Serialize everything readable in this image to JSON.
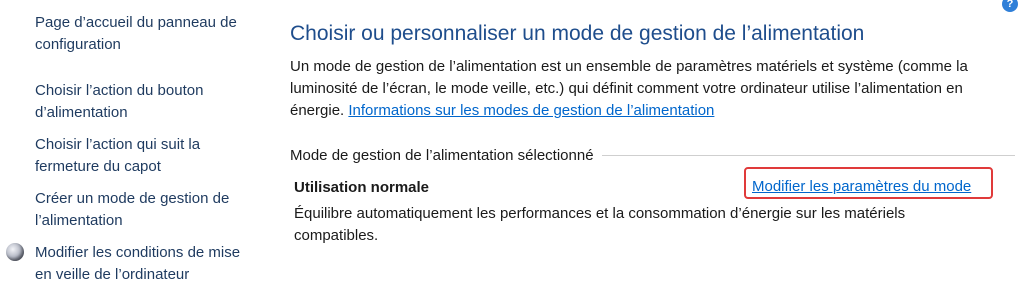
{
  "sidebar": {
    "items": [
      {
        "label": "Page d’accueil du panneau de configuration"
      },
      {
        "label": "Choisir l’action du bouton d’alimentation"
      },
      {
        "label": "Choisir l’action qui suit la fermeture du capot"
      },
      {
        "label": "Créer un mode de gestion de l’alimentation"
      },
      {
        "label": "Modifier les conditions de mise en veille de l’ordinateur",
        "icon": "moon-icon"
      }
    ]
  },
  "header": {
    "help_icon": "help-icon",
    "help_glyph": "?"
  },
  "main": {
    "title": "Choisir ou personnaliser un mode de gestion de l’alimentation",
    "description": "Un mode de gestion de l’alimentation est un ensemble de paramètres matériels et système (comme la luminosité de l’écran, le mode veille, etc.) qui définit comment votre ordinateur utilise l’alimentation en énergie.",
    "info_link": "Informations sur les modes de gestion de l’alimentation",
    "section_label": "Mode de gestion de l’alimentation sélectionné",
    "plan": {
      "name": "Utilisation normale",
      "modify_link": "Modifier les paramètres du mode",
      "description": "Équilibre automatiquement les performances et la consommation d’énergie sur les matériels compatibles."
    }
  },
  "colors": {
    "title": "#1e4d8c",
    "link": "#0066cc",
    "highlight_box": "#e03a3a"
  }
}
